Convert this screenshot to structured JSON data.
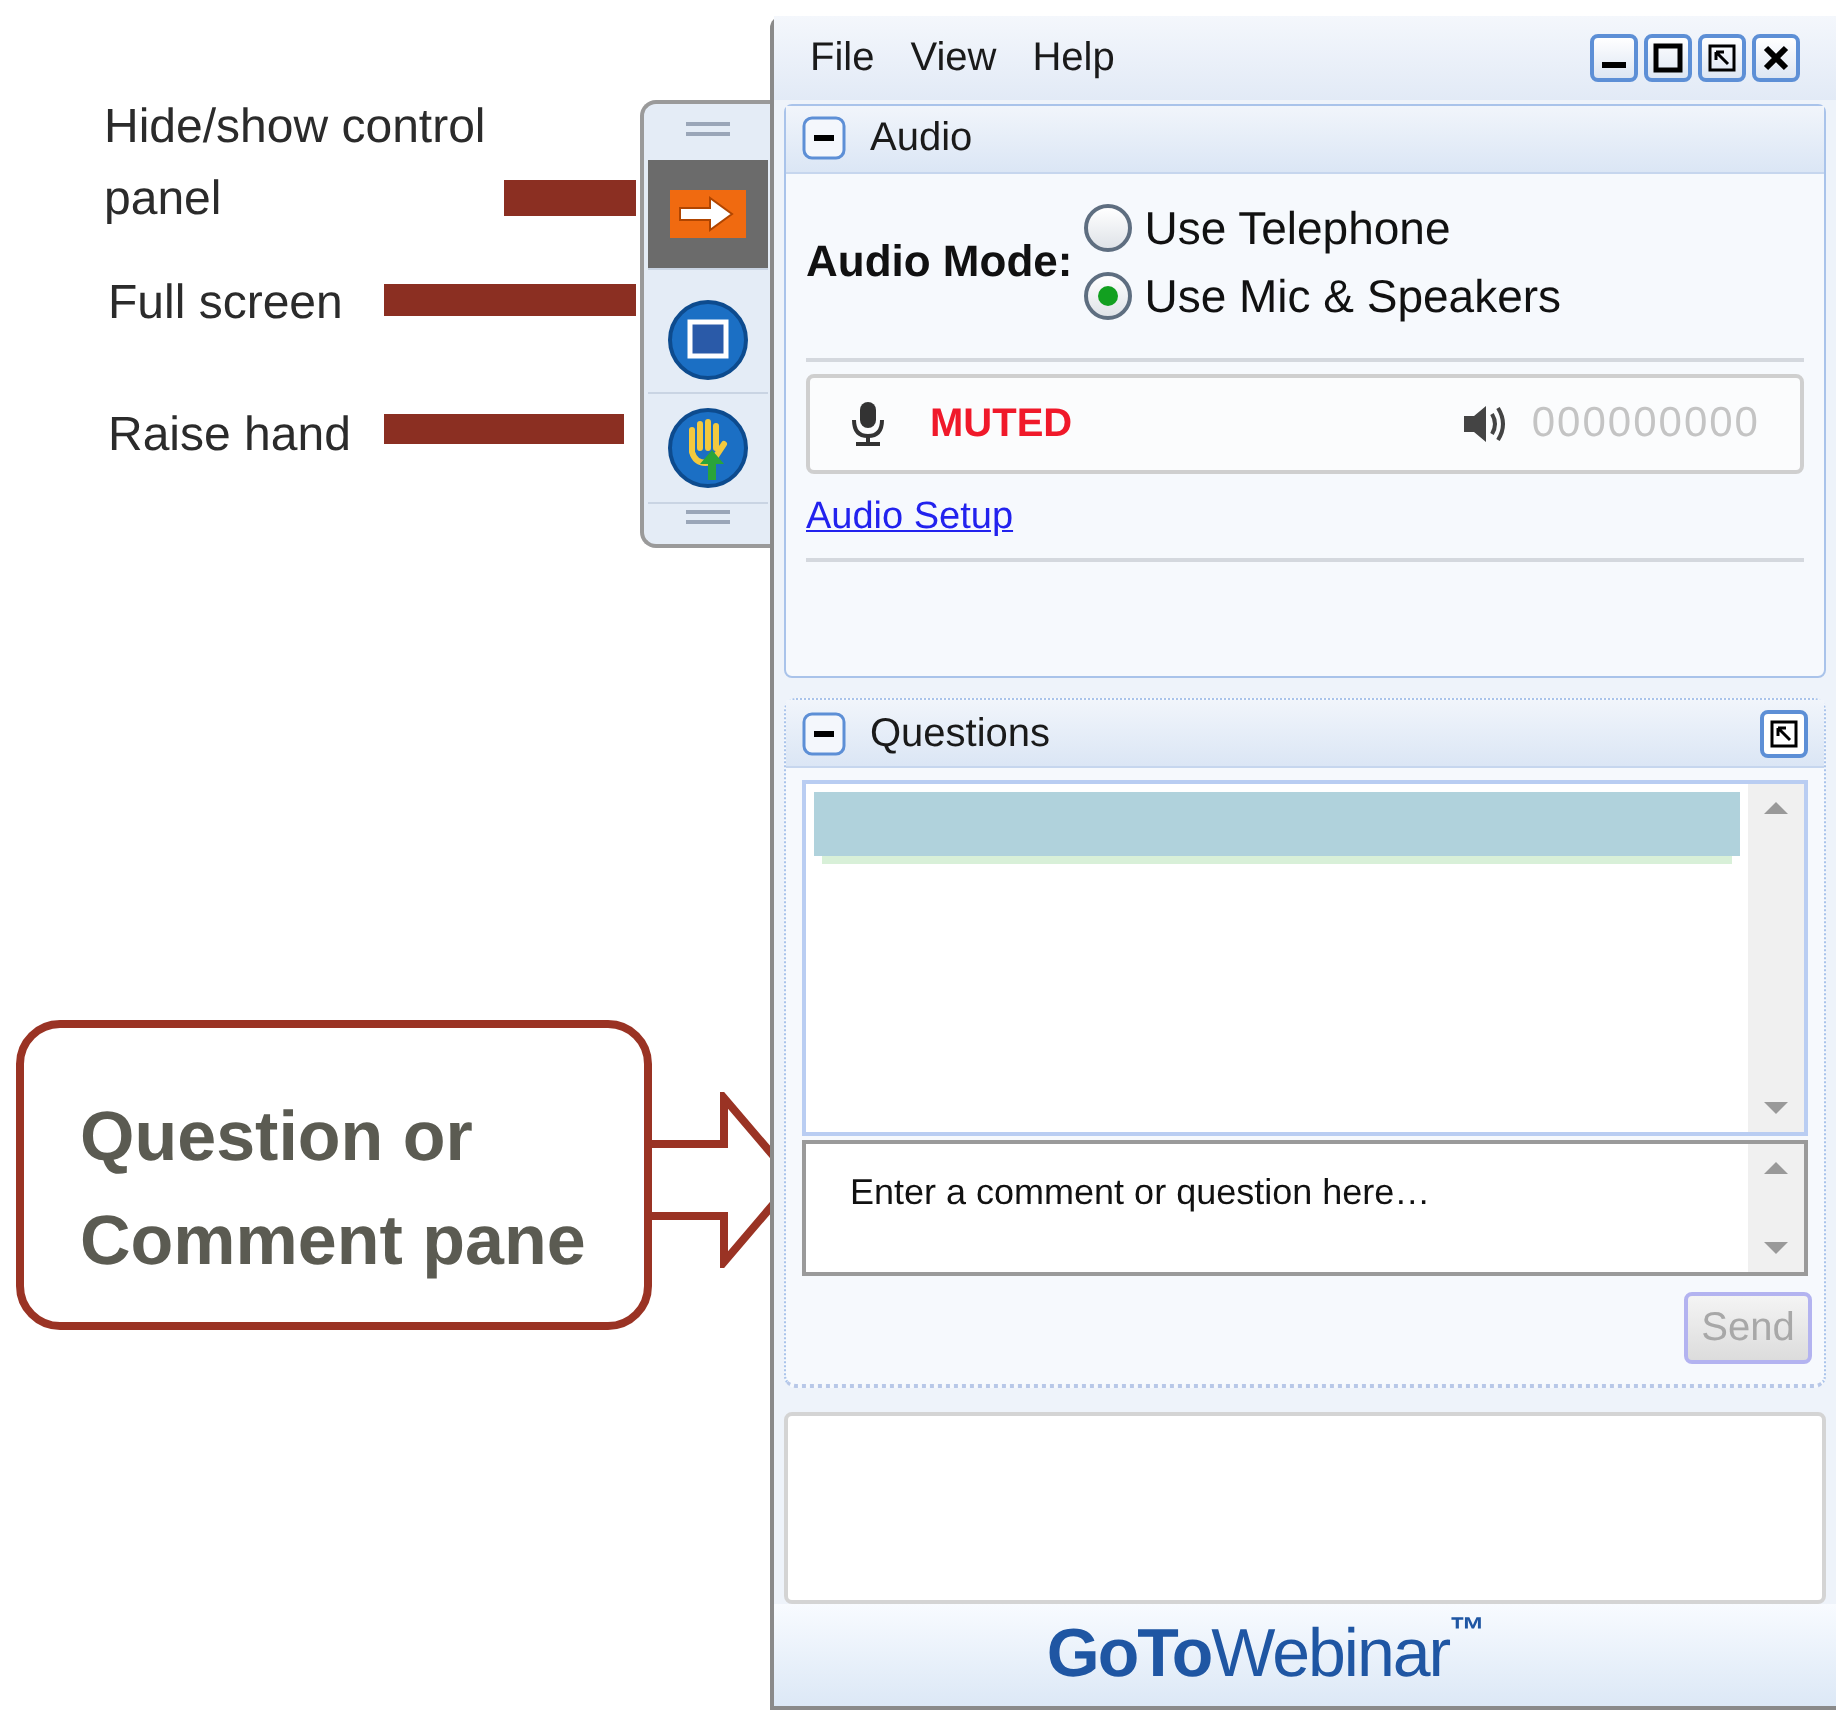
{
  "annotations": [
    {
      "text": "Hide/show control panel"
    },
    {
      "text": "Full screen"
    },
    {
      "text": "Raise hand"
    }
  ],
  "callout": {
    "text": "Question or Comment pane"
  },
  "toolbar": {
    "buttons": [
      {
        "kind": "hide_show",
        "selected": true
      },
      {
        "kind": "fullscreen",
        "selected": false
      },
      {
        "kind": "raise_hand",
        "selected": false
      }
    ]
  },
  "menu": [
    "File",
    "View",
    "Help"
  ],
  "audio": {
    "title": "Audio",
    "expanded": true,
    "mode_label": "Audio Mode:",
    "options": [
      {
        "label": "Use Telephone",
        "selected": false
      },
      {
        "label": "Use Mic & Speakers",
        "selected": true
      }
    ],
    "mic_status": "MUTED",
    "speaker_level": "000000000",
    "setup_link": "Audio Setup"
  },
  "questions": {
    "title": "Questions",
    "expanded": true,
    "input": {
      "placeholder": "Enter a comment or question here…"
    },
    "send": {
      "label": "Send",
      "disabled": true
    }
  },
  "logo": {
    "bold": "GoTo",
    "light": "Webinar",
    "mark": "™"
  }
}
